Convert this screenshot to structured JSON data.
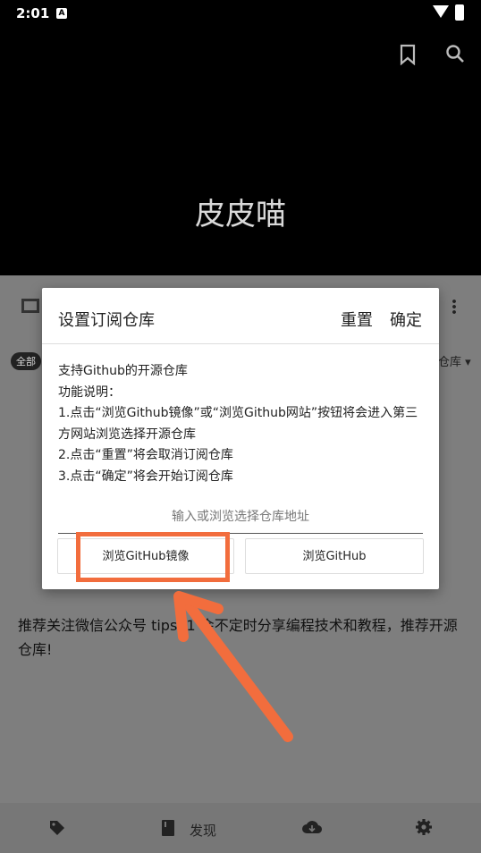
{
  "status_bar": {
    "time": "2:01",
    "notification_letter": "A"
  },
  "header": {
    "title": "皮皮喵"
  },
  "background_page": {
    "chip_all": "全部",
    "repo_dropdown": "仓库 ▾",
    "recommend_text": "推荐关注微信公众号 tips21 会不定时分享编程技术和教程，推荐开源仓库!",
    "bottom_nav": {
      "discover_label": "发现"
    }
  },
  "dialog": {
    "title": "设置订阅仓库",
    "reset_label": "重置",
    "confirm_label": "确定",
    "description": "支持Github的开源仓库\n功能说明：\n1.点击“浏览Github镜像”或“浏览Github网站”按钮将会进入第三方网站浏览选择开源仓库\n2.点击“重置”将会取消订阅仓库\n3.点击“确定”将会开始订阅仓库",
    "input_placeholder": "输入或浏览选择仓库地址",
    "browse_mirror_label": "浏览GitHub镜像",
    "browse_github_label": "浏览GitHub"
  },
  "annotation": {
    "highlight_color": "#f26d3d"
  }
}
